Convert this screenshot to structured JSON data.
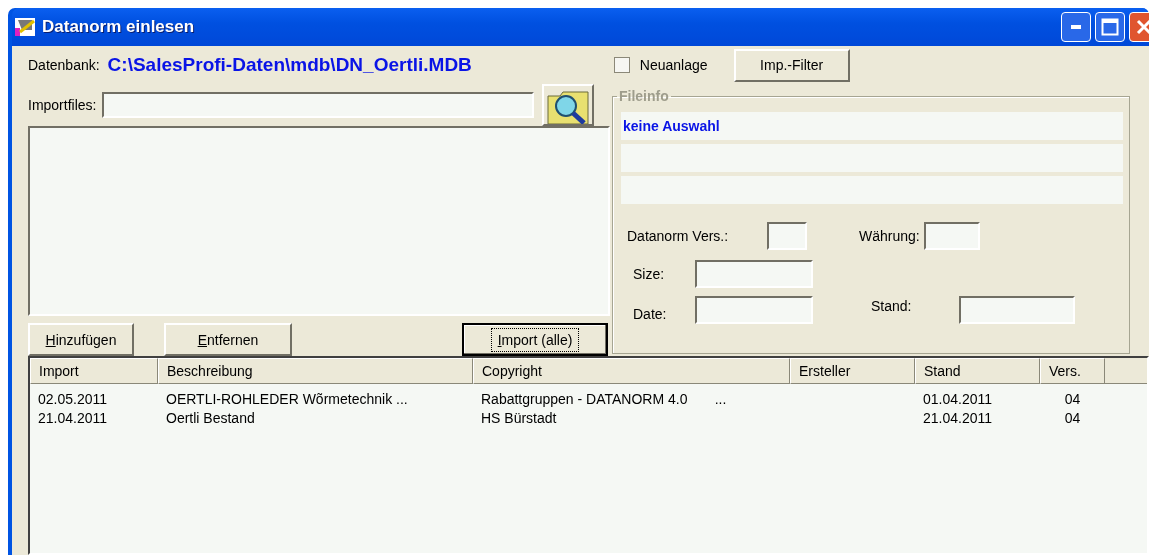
{
  "window": {
    "title": "Datanorm einlesen"
  },
  "database": {
    "label": "Datenbank:",
    "path": "C:\\SalesProfi-Daten\\mdb\\DN_Oertli.MDB"
  },
  "new_entry": {
    "label": "Neuanlage",
    "checked": false
  },
  "filter_button": {
    "label": "Imp.-Filter"
  },
  "import_files": {
    "label": "Importfiles:"
  },
  "buttons": [
    {
      "label": "Hinzufügen",
      "default": false
    },
    {
      "label": "Entfernen",
      "default": false
    },
    {
      "label": "Import (alle)",
      "default": true
    }
  ],
  "fileinfo": {
    "title": "Fileinfo",
    "selection": "keine Auswahl",
    "fields": [
      {
        "label": "Datanorm Vers.:"
      },
      {
        "label": "Währung:"
      },
      {
        "label": "Size:"
      },
      {
        "label": "Date:"
      },
      {
        "label": "Stand:"
      }
    ]
  },
  "table": {
    "columns": [
      "Import",
      "Beschreibung",
      "Copyright",
      "Ersteller",
      "Stand",
      "Vers."
    ],
    "rows": [
      [
        "02.05.2011",
        "OERTLI-ROHLEDER Wõrmetechnik ...",
        "Rabattgruppen - DATANORM 4.0       ...",
        "",
        "01.04.2011",
        "04"
      ],
      [
        "21.04.2011",
        "Oertli Bestand",
        "HS Bürstadt",
        "",
        "21.04.2011",
        "04"
      ]
    ]
  }
}
